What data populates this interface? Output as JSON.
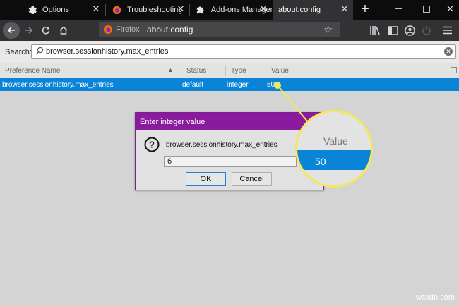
{
  "browser": {
    "tabs": [
      {
        "label": "Options",
        "icon": "gear-icon"
      },
      {
        "label": "Troubleshooting Information",
        "icon": "firefox-logo-icon"
      },
      {
        "label": "Add-ons Manager",
        "icon": "puzzle-icon"
      },
      {
        "label": "about:config",
        "icon": "none"
      }
    ],
    "active_tab": 3,
    "new_tab_symbol": "+",
    "window_controls": [
      "minimize",
      "maximize",
      "close"
    ],
    "url_identity": "Firefox",
    "url": "about:config"
  },
  "config": {
    "search_label": "Search:",
    "search_value": "browser.sessionhistory.max_entries",
    "columns": [
      "Preference Name",
      "Status",
      "Type",
      "Value"
    ],
    "rows": [
      {
        "name": "browser.sessionhistory.max_entries",
        "status": "default",
        "type": "integer",
        "value": "50"
      }
    ]
  },
  "dialog": {
    "title": "Enter integer value",
    "pref_name": "browser.sessionhistory.max_entries",
    "input_value": "6",
    "ok_label": "OK",
    "cancel_label": "Cancel"
  },
  "callout": {
    "header": "Value",
    "value": "50"
  },
  "watermark": "wsxdn.com",
  "colors": {
    "accent_selection": "#0a84d6",
    "dialog_title": "#8a1a9e",
    "callout_ring": "#f3e75a",
    "tabstrip": "#0c0c0d"
  }
}
